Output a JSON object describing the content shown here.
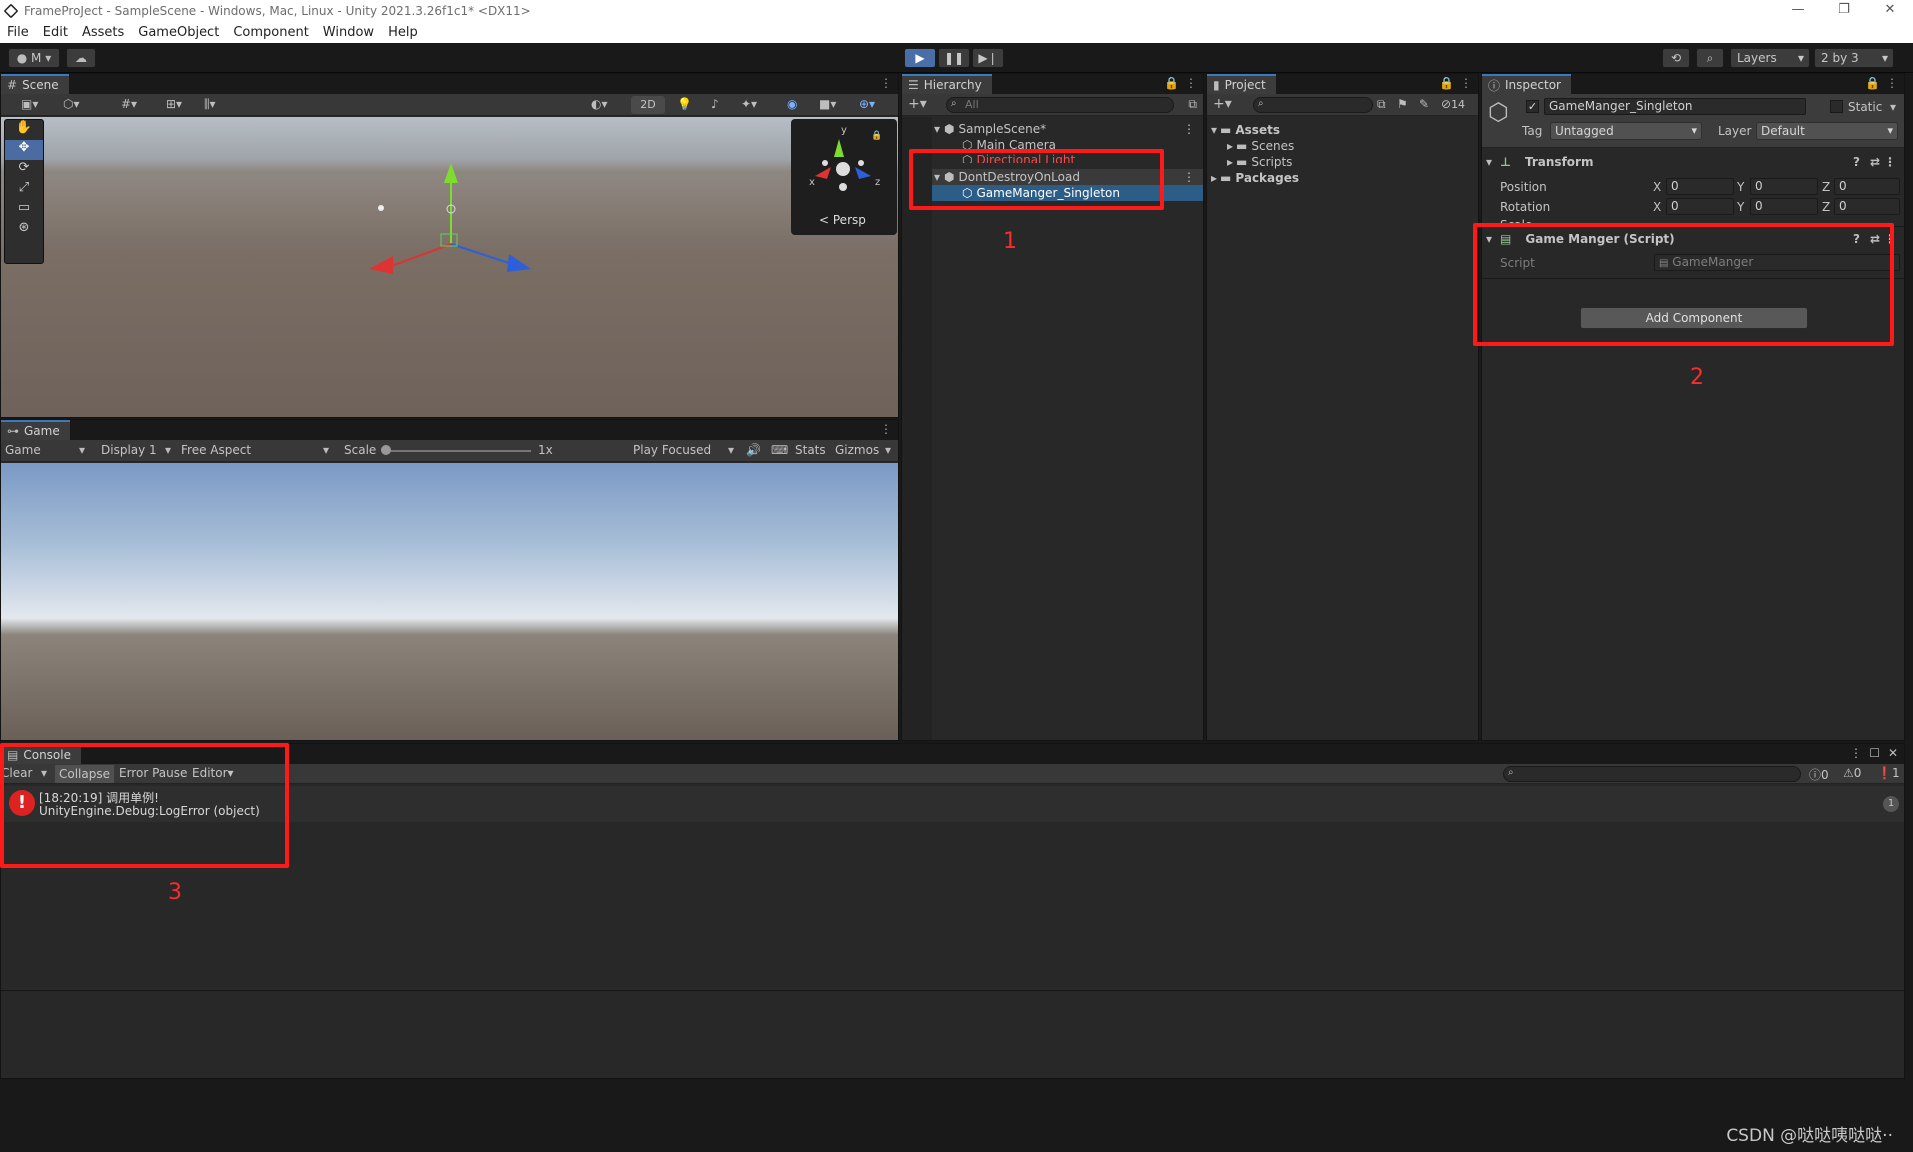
{
  "window": {
    "title": "FrameProJect - SampleScene - Windows, Mac, Linux - Unity 2021.3.26f1c1* <DX11>",
    "controls": [
      "—",
      "❐",
      "✕"
    ]
  },
  "menu": [
    "File",
    "Edit",
    "Assets",
    "GameObject",
    "Component",
    "Window",
    "Help"
  ],
  "toolbar": {
    "account_label": "M",
    "layers_label": "Layers",
    "layout_label": "2 by 3"
  },
  "scene": {
    "tab": "Scene",
    "mode_2d": "2D",
    "gizmo_y": "y",
    "gizmo_x": "x",
    "gizmo_z": "z",
    "persp_label": "Persp"
  },
  "game": {
    "tab": "Game",
    "game_dd": "Game",
    "display_dd": "Display 1",
    "aspect_dd": "Free Aspect",
    "scale_label": "Scale",
    "scale_value": "1x",
    "play_focused": "Play Focused",
    "stats": "Stats",
    "gizmos": "Gizmos"
  },
  "hierarchy": {
    "tab": "Hierarchy",
    "search_placeholder": "All",
    "items": [
      {
        "label": "SampleScene*"
      },
      {
        "label": "Main Camera"
      },
      {
        "label": "Directional Light"
      },
      {
        "label": "DontDestroyOnLoad"
      },
      {
        "label": "GameManger_Singleton"
      }
    ]
  },
  "project": {
    "tab": "Project",
    "hidden_count": "14",
    "tree": [
      {
        "label": "Assets"
      },
      {
        "label": "Scenes"
      },
      {
        "label": "Scripts"
      },
      {
        "label": "Packages"
      }
    ]
  },
  "inspector": {
    "tab": "Inspector",
    "object_name": "GameManger_Singleton",
    "static_label": "Static",
    "tag_label": "Tag",
    "tag_value": "Untagged",
    "layer_label": "Layer",
    "layer_value": "Default",
    "transform": {
      "title": "Transform",
      "position_label": "Position",
      "rotation_label": "Rotation",
      "scale_label": "Scale",
      "x": "X",
      "y": "Y",
      "z": "Z",
      "position": [
        "0",
        "0",
        "0"
      ],
      "rotation": [
        "0",
        "0",
        "0"
      ]
    },
    "script_component": {
      "title": "Game Manger (Script)",
      "script_label": "Script",
      "script_value": "GameManger"
    },
    "add_component": "Add Component"
  },
  "console": {
    "tab": "Console",
    "clear": "Clear",
    "collapse": "Collapse",
    "error_pause": "Error Pause",
    "editor": "Editor",
    "info_count": "0",
    "warn_count": "0",
    "error_count": "1",
    "entry_line1": "[18:20:19] 调用单例!",
    "entry_line2": "UnityEngine.Debug:LogError (object)",
    "entry_count": "1"
  },
  "annotations": [
    "1",
    "2",
    "3"
  ],
  "watermark": "CSDN @哒哒咦哒哒··"
}
